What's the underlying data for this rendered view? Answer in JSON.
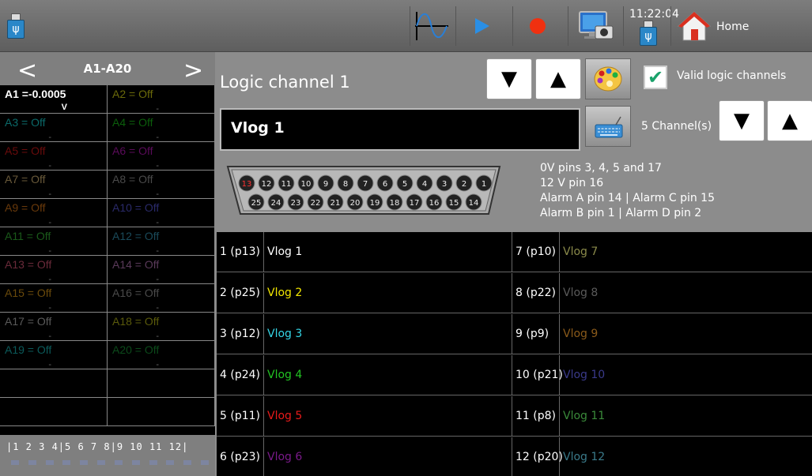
{
  "topbar": {
    "clock": "11:22:04",
    "home_label": "Home",
    "icons": [
      "usb-icon",
      "waveform-icon",
      "play-icon",
      "record-icon",
      "monitor-icon",
      "usb-icon",
      "home-icon"
    ]
  },
  "left_panel": {
    "range": "A1-A20",
    "prev": "<",
    "next": ">",
    "cells": [
      {
        "text": "A1 =-0.0005",
        "unit": "V",
        "color": "#ffffff"
      },
      {
        "text": "A2 = Off",
        "color": "#6b6a0a"
      },
      {
        "text": "A3 = Off",
        "color": "#0b6a6a"
      },
      {
        "text": "A4 = Off",
        "color": "#0b5e0b"
      },
      {
        "text": "A5 = Off",
        "color": "#6a0b0b"
      },
      {
        "text": "A6 = Off",
        "color": "#5a0b5a"
      },
      {
        "text": "A7 = Off",
        "color": "#6a5a3a"
      },
      {
        "text": "A8 = Off",
        "color": "#4a4a4a"
      },
      {
        "text": "A9 = Off",
        "color": "#6a3a0b"
      },
      {
        "text": "A10 = Off",
        "color": "#2a2a6a"
      },
      {
        "text": "A11 = Off",
        "color": "#1a5a1a"
      },
      {
        "text": "A12 = Off",
        "color": "#1a4a5a"
      },
      {
        "text": "A13 = Off",
        "color": "#6a2a3a"
      },
      {
        "text": "A14 = Off",
        "color": "#5a3a5a"
      },
      {
        "text": "A15 = Off",
        "color": "#6a4a0b"
      },
      {
        "text": "A16 = Off",
        "color": "#4a4a4a"
      },
      {
        "text": "A17 = Off",
        "color": "#5a5a5a"
      },
      {
        "text": "A18 = Off",
        "color": "#5a5a0b"
      },
      {
        "text": "A19 = Off",
        "color": "#0b5a5a"
      },
      {
        "text": "A20 = Off",
        "color": "#0b4a1a"
      }
    ],
    "ruler": "|1  2  3  4|5  6  7  8|9 10 11 12|"
  },
  "header": {
    "title": "Logic channel 1",
    "down": "▼",
    "up": "▲",
    "valid_label": "Valid logic channels",
    "channel_count": "5 Channel(s)",
    "name_value": "Vlog  1"
  },
  "connector": {
    "top_pins": [
      "13",
      "12",
      "11",
      "10",
      "9",
      "8",
      "7",
      "6",
      "5",
      "4",
      "3",
      "2",
      "1"
    ],
    "bottom_pins": [
      "25",
      "24",
      "23",
      "22",
      "21",
      "20",
      "19",
      "18",
      "17",
      "16",
      "15",
      "14"
    ],
    "highlight": "13"
  },
  "pin_info": [
    "0V pins 3, 4, 5 and 17",
    "12 V pin  16",
    "Alarm A pin 14 | Alarm C pin 15",
    "Alarm B pin 1 | Alarm D pin 2"
  ],
  "channels": [
    {
      "pin": "1 (p13)",
      "name": "Vlog  1",
      "color": "#ffffff"
    },
    {
      "pin": "2 (p25)",
      "name": "Vlog  2",
      "color": "#f2e600"
    },
    {
      "pin": "3 (p12)",
      "name": "Vlog  3",
      "color": "#35d6e6"
    },
    {
      "pin": "4 (p24)",
      "name": "Vlog  4",
      "color": "#22c322"
    },
    {
      "pin": "5 (p11)",
      "name": "Vlog  5",
      "color": "#e81a1a"
    },
    {
      "pin": "6 (p23)",
      "name": "Vlog  6",
      "color": "#7a1a8a"
    },
    {
      "pin": "7 (p10)",
      "name": "Vlog  7",
      "color": "#8a8a4a"
    },
    {
      "pin": "8 (p22)",
      "name": "Vlog  8",
      "color": "#5a5a5a"
    },
    {
      "pin": "9 (p9)",
      "name": "Vlog  9",
      "color": "#8a5a1a"
    },
    {
      "pin": "10 (p21)",
      "name": "Vlog 10",
      "color": "#3a3a8a"
    },
    {
      "pin": "11 (p8)",
      "name": "Vlog 11",
      "color": "#3a8a3a"
    },
    {
      "pin": "12 (p20)",
      "name": "Vlog 12",
      "color": "#3a7a8a"
    }
  ]
}
